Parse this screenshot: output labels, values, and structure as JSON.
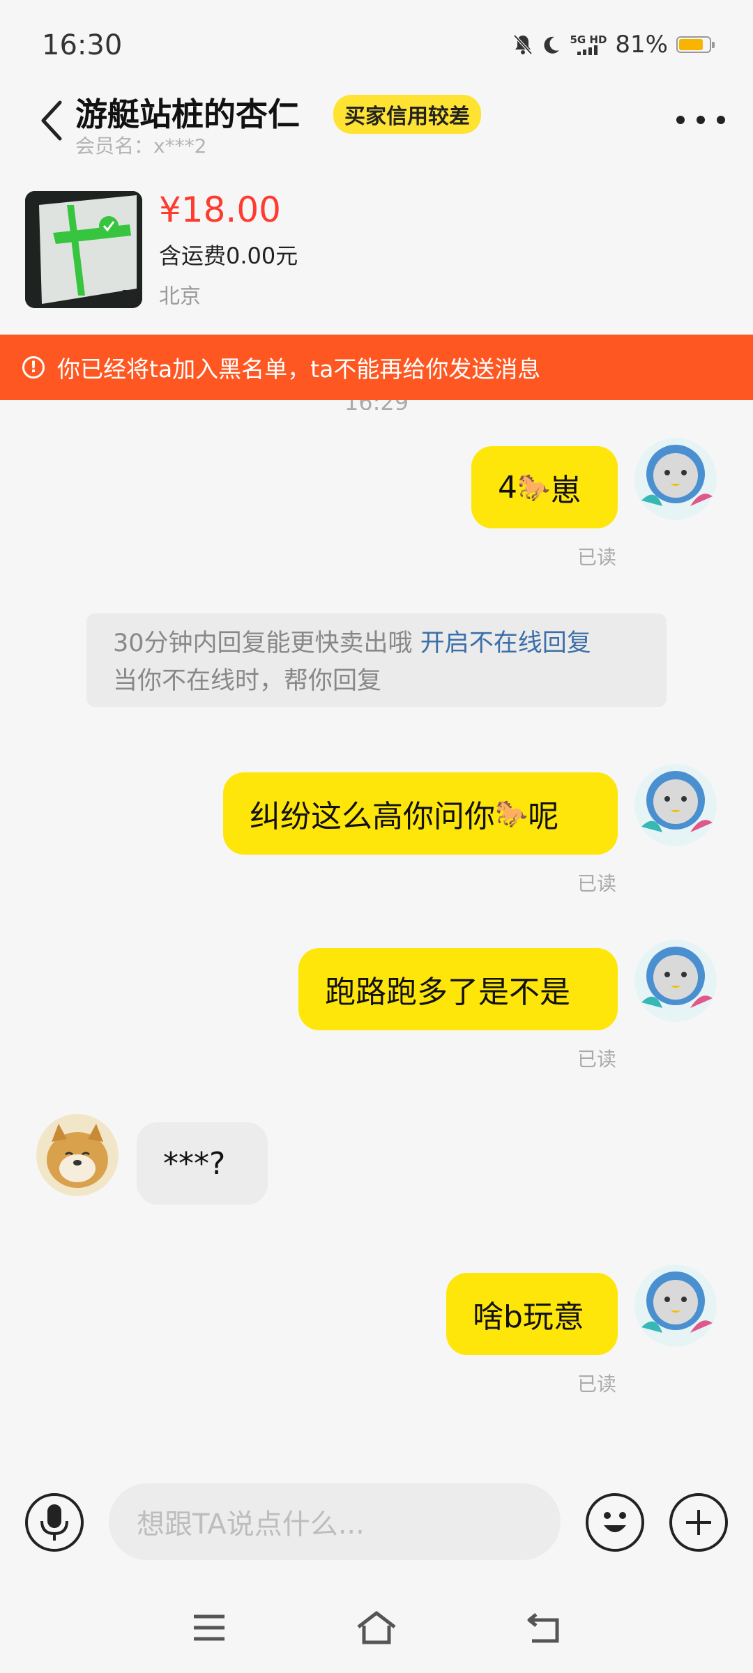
{
  "status_bar": {
    "time": "16:30",
    "network_label": "5G HD",
    "battery": "81%",
    "battery_level": 0.81
  },
  "header": {
    "title": "游艇站桩的杏仁",
    "credit_badge": "买家信用较差",
    "member_name": "会员名：x***2"
  },
  "product": {
    "price": "¥18.00",
    "shipping": "含运费0.00元",
    "location": "北京"
  },
  "banner": {
    "text": "你已经将ta加入黑名单，ta不能再给你发送消息"
  },
  "peek_time": "16:29",
  "messages": [
    {
      "text_before": "4",
      "emoji": "🐎",
      "text_after": "崽",
      "read": "已读"
    },
    {
      "text_before": "纠纷这么高你问你",
      "emoji": "🐎",
      "text_after": "呢",
      "read": "已读"
    },
    {
      "text": "跑路跑多了是不是",
      "read": "已读"
    },
    {
      "text": "***?"
    },
    {
      "text": "啥b玩意",
      "read": "已读"
    }
  ],
  "system_tip": {
    "text": "30分钟内回复能更快卖出哦",
    "link": "开启不在线回复",
    "line2": "当你不在线时，帮你回复"
  },
  "input": {
    "placeholder": "想跟TA说点什么..."
  },
  "icons": {
    "accent": "#ffe60a",
    "warning": "#ff5722",
    "price_color": "#ff3b30"
  }
}
